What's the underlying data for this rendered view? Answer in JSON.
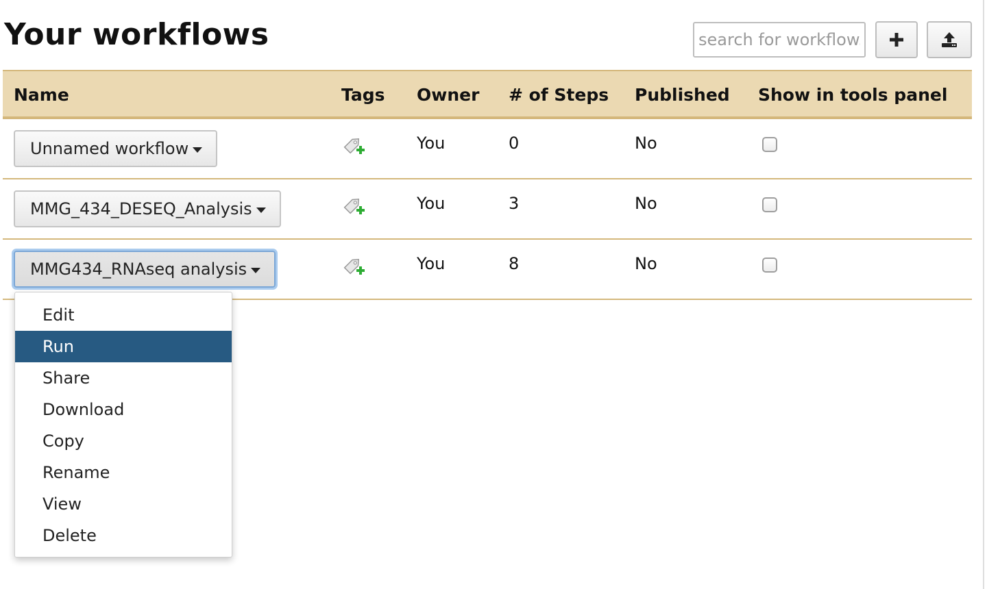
{
  "page": {
    "title": "Your workflows"
  },
  "toolbar": {
    "search_placeholder": "search for workflow.",
    "new_icon": "plus-icon",
    "upload_icon": "upload-icon"
  },
  "table": {
    "columns": [
      "Name",
      "Tags",
      "Owner",
      "# of Steps",
      "Published",
      "Show in tools panel"
    ],
    "rows": [
      {
        "name": "Unnamed workflow",
        "owner": "You",
        "steps": "0",
        "published": "No",
        "show_in_tools": false
      },
      {
        "name": "MMG_434_DESEQ_Analysis",
        "owner": "You",
        "steps": "3",
        "published": "No",
        "show_in_tools": false
      },
      {
        "name": "MMG434_RNAseq analysis",
        "owner": "You",
        "steps": "8",
        "published": "No",
        "show_in_tools": false
      }
    ]
  },
  "dropdown": {
    "open_for_row": 2,
    "selected": "Run",
    "items": [
      "Edit",
      "Run",
      "Share",
      "Download",
      "Copy",
      "Rename",
      "View",
      "Delete"
    ]
  },
  "colors": {
    "header_bg": "#ebd9b2",
    "header_border": "#d4b77b",
    "menu_selected": "#275a82",
    "tag_add": "#2eac34"
  },
  "icons": {
    "tag": "tag-add-icon",
    "caret": "caret-down-icon"
  }
}
